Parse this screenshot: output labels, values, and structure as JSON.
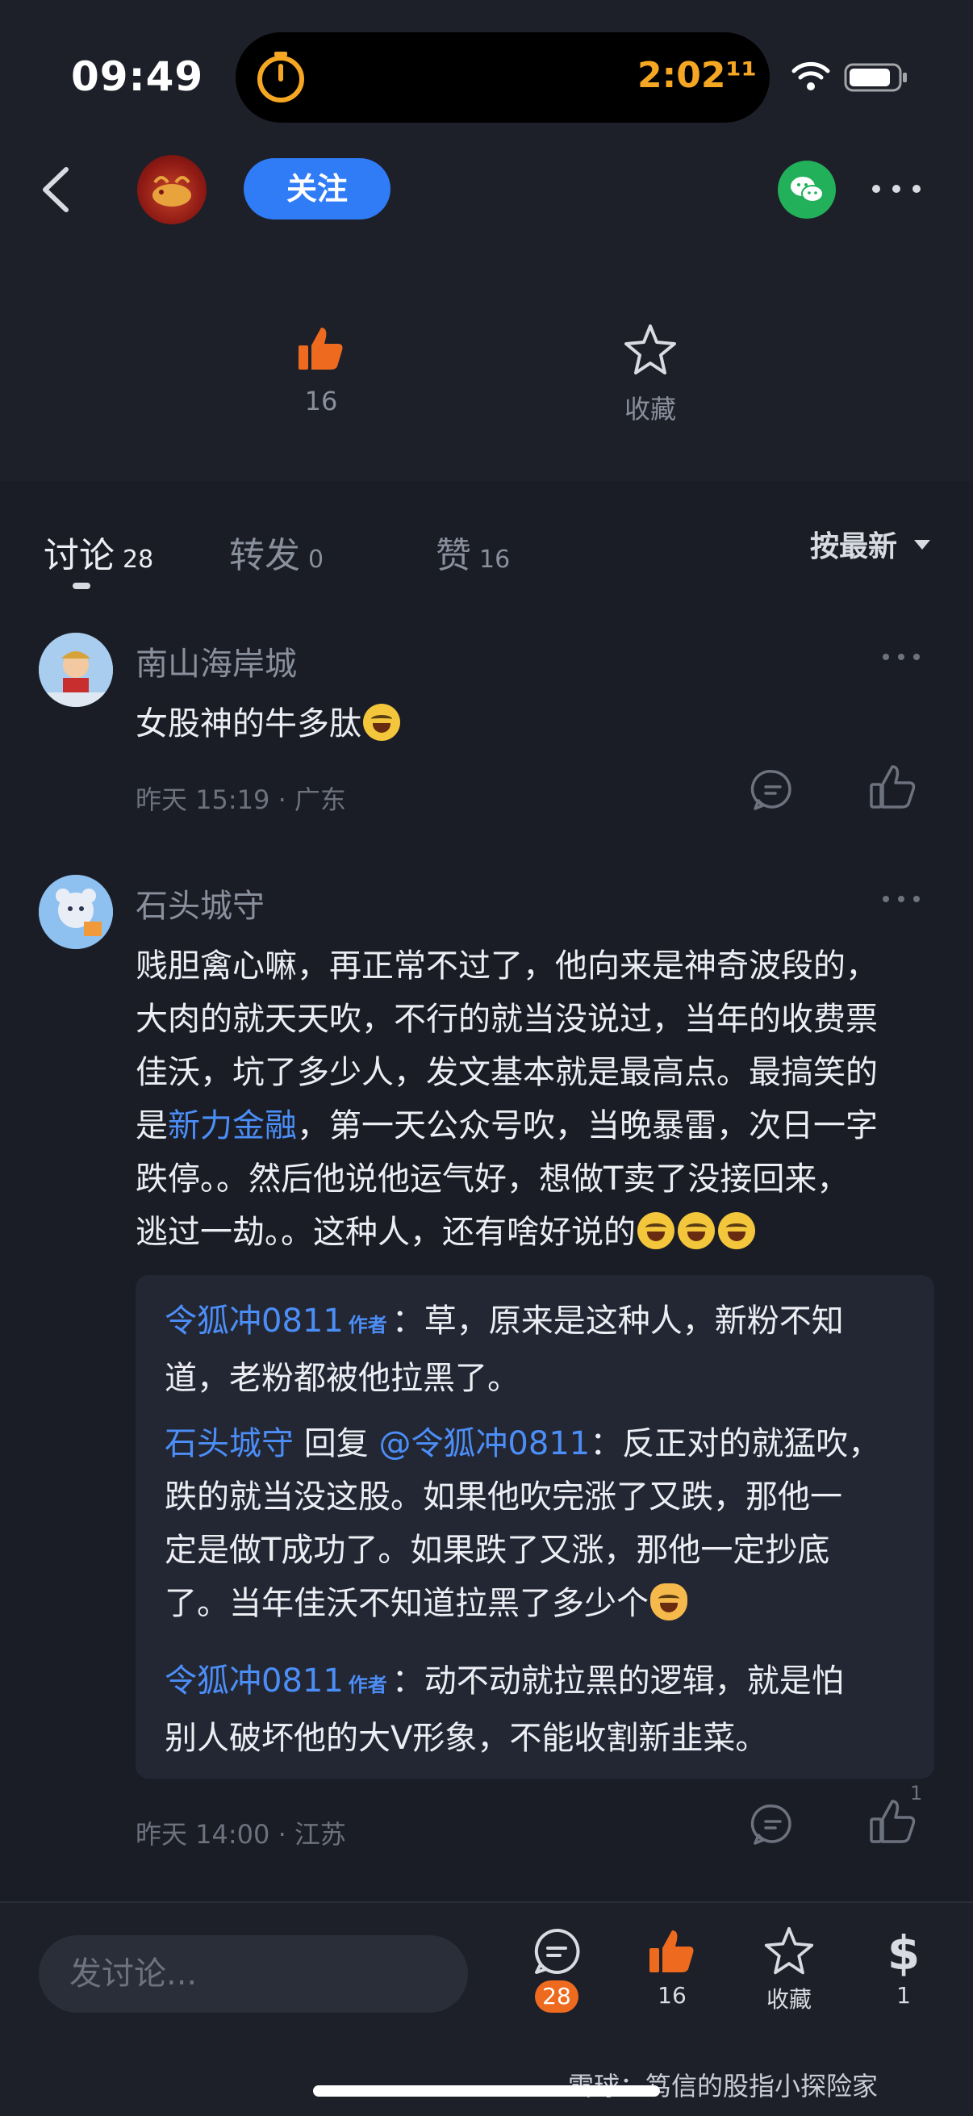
{
  "status_bar": {
    "time": "09:49",
    "timer": "2:02¹¹"
  },
  "nav": {
    "follow_label": "关注"
  },
  "actions": {
    "like_count": "16",
    "favorite_label": "收藏"
  },
  "tabs": [
    {
      "label": "讨论",
      "count": "28"
    },
    {
      "label": "转发",
      "count": "0"
    },
    {
      "label": "赞",
      "count": "16"
    }
  ],
  "sort": {
    "label": "按最新"
  },
  "comments": [
    {
      "username": "南山海岸城",
      "text": "女股神的牛多肽",
      "time": "昨天 15:19",
      "location": "广东"
    },
    {
      "username": "石头城守",
      "text_parts": [
        "贱胆禽心嘛，再正常不过了，他向来是神奇波段的，",
        "大肉的就天天吹，不行的就当没说过，当年的收费票",
        "佳沃，坑了多少人，发文基本就是最高点。最搞笑的",
        "是",
        "新力金融",
        "，第一天公众号吹，当晚暴雷，次日一字",
        "跌停。。然后他说他运气好，想做T卖了没接回来，",
        "逃过一劫。。这种人，还有啥好说的"
      ],
      "time": "昨天 14:00",
      "location": "江苏",
      "like_count": "1",
      "replies": [
        {
          "author": "令狐冲0811",
          "author_tag": "作者",
          "lines": [
            "：草，原来是这种人，新粉不知",
            "道，老粉都被他拉黑了。"
          ]
        },
        {
          "author": "石头城守",
          "reply_word": "回复",
          "target": "@令狐冲0811",
          "lines": [
            "：反正对的就猛吹，",
            "跌的就当没这股。如果他吹完涨了又跌，那他一",
            "定是做T成功了。如果跌了又涨，那他一定抄底",
            "了。当年佳沃不知道拉黑了多少个"
          ]
        },
        {
          "author": "令狐冲0811",
          "author_tag": "作者",
          "lines": [
            "：动不动就拉黑的逻辑，就是怕",
            "别人破坏他的大V形象，不能收割新韭菜。"
          ]
        }
      ]
    }
  ],
  "bottom_bar": {
    "compose_placeholder": "发讨论...",
    "comment_count": "28",
    "like_count": "16",
    "favorite_label": "收藏",
    "reward_count": "1"
  },
  "watermark": "雪球：笃信的股指小探险家",
  "colors": {
    "accent_blue": "#2f7cf6",
    "like_orange": "#ee6a1f",
    "wechat_green": "#22b05b",
    "link_blue": "#4c8ef7"
  }
}
